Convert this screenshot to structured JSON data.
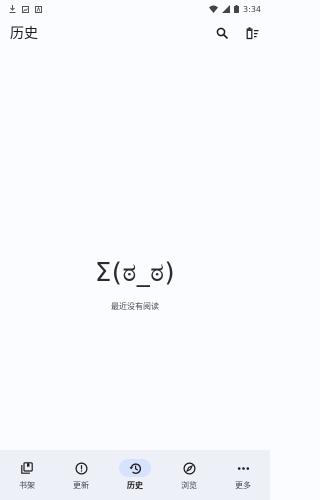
{
  "status_bar": {
    "time": "3:34"
  },
  "app_bar": {
    "title": "历史"
  },
  "empty_state": {
    "kaomoji": "Σ(ಠ_ಠ)",
    "message": "最近没有阅读"
  },
  "bottom_nav": {
    "items": [
      {
        "label": "书架",
        "icon": "library-icon"
      },
      {
        "label": "更新",
        "icon": "updates-icon"
      },
      {
        "label": "历史",
        "icon": "history-icon",
        "active": true
      },
      {
        "label": "浏览",
        "icon": "explore-icon"
      },
      {
        "label": "更多",
        "icon": "more-icon"
      }
    ]
  },
  "colors": {
    "nav_active_indicator": "#d7e2ff",
    "nav_background": "#eef0f8",
    "background": "#fbfcff"
  }
}
